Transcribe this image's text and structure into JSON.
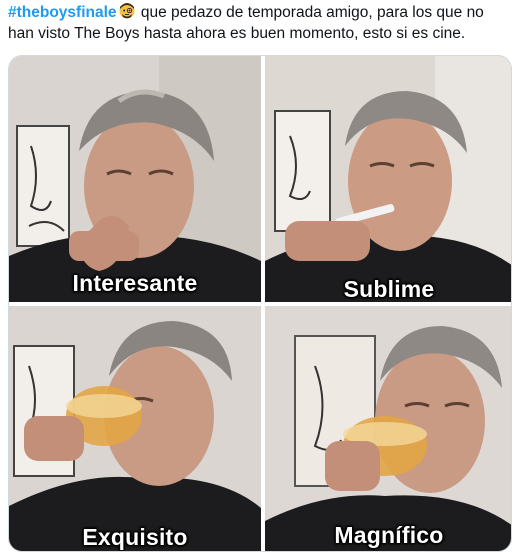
{
  "tweet": {
    "hashtag": "#theboysfinale",
    "emoji_icon": "face-with-monocle-emoji",
    "text": " que pedazo de temporada amigo, para los que no han visto The Boys hasta ahora es buen momento, esto si es cine."
  },
  "meme": {
    "panels": [
      {
        "caption": "Interesante"
      },
      {
        "caption": "Sublime"
      },
      {
        "caption": "Exquisito"
      },
      {
        "caption": "Magnífico"
      }
    ]
  },
  "colors": {
    "hashtag": "#1d9bf0",
    "text": "#0f1419",
    "caption": "#ffffff"
  }
}
